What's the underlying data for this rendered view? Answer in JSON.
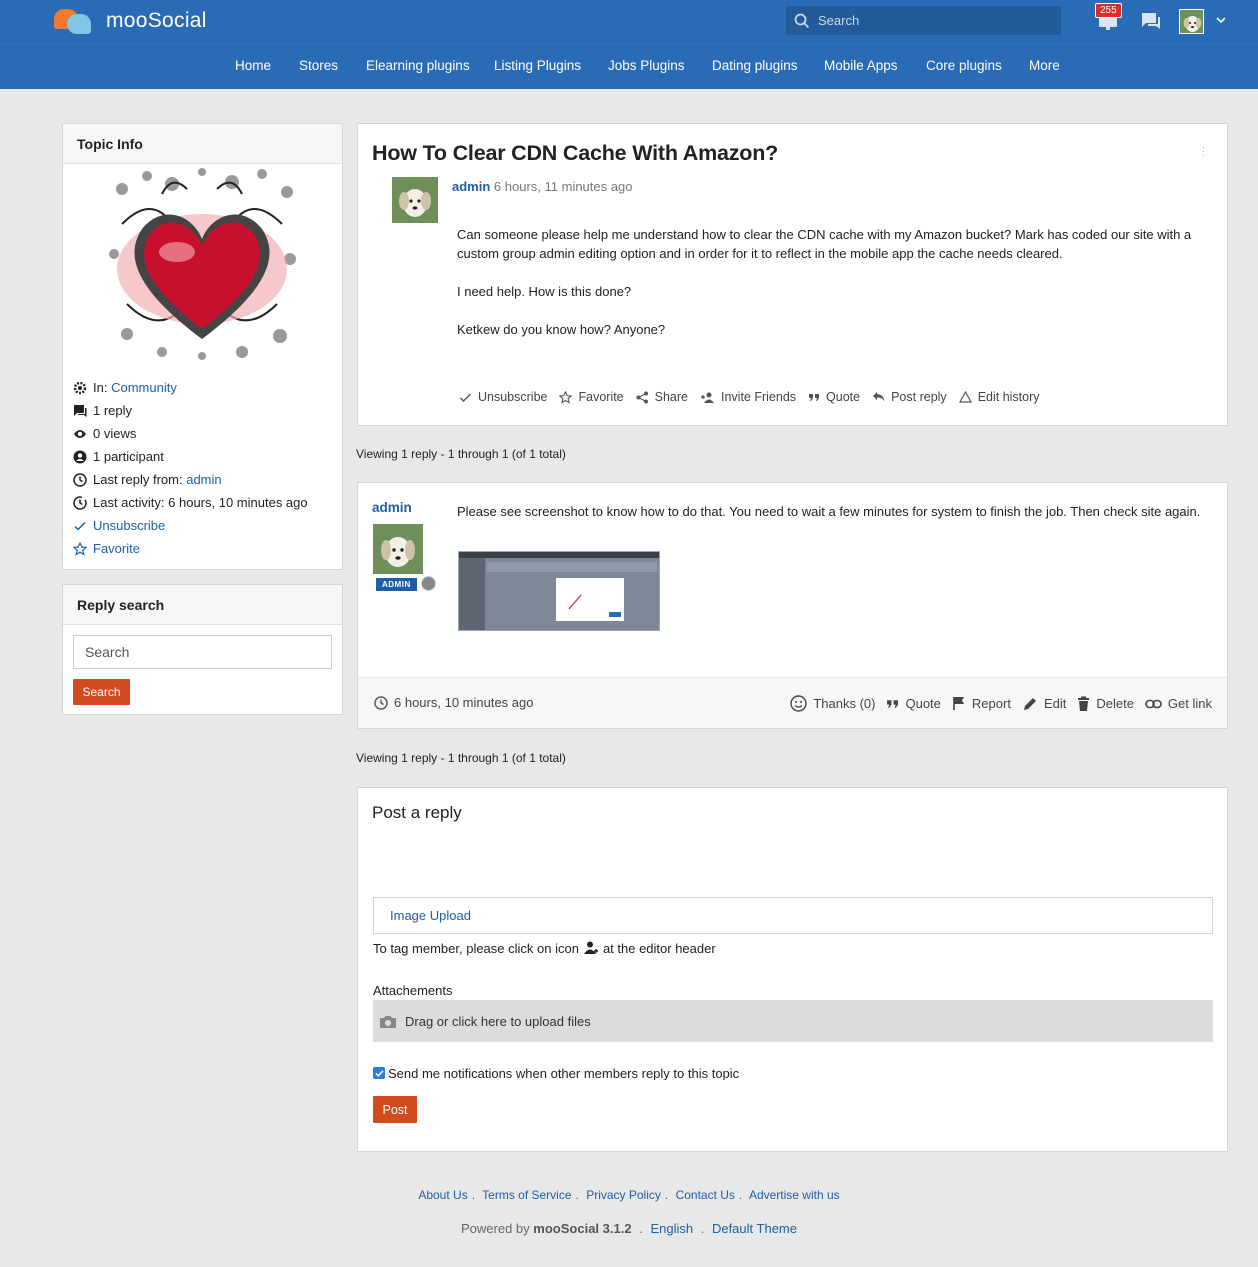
{
  "header": {
    "logo_text": "mooSocial",
    "search_placeholder": "Search",
    "notification_count": "255"
  },
  "nav": {
    "items": [
      "Home",
      "Stores",
      "Elearning plugins",
      "Listing Plugins",
      "Jobs Plugins",
      "Dating plugins",
      "Mobile Apps",
      "Core plugins",
      "More"
    ]
  },
  "topic_info": {
    "heading": "Topic Info",
    "in_label": "In:",
    "in_link": "Community",
    "replies": "1 reply",
    "views": "0 views",
    "participants": "1 participant",
    "last_reply_label": "Last reply from:",
    "last_reply_user": "admin",
    "last_activity": "Last activity: 6 hours, 10 minutes ago",
    "unsubscribe": "Unsubscribe",
    "favorite": "Favorite"
  },
  "reply_search": {
    "heading": "Reply search",
    "placeholder": "Search",
    "button": "Search"
  },
  "topic": {
    "title": "How To Clear CDN Cache With Amazon?",
    "author": "admin",
    "time": "6 hours, 11 minutes ago",
    "body": [
      "Can someone please help me understand how to clear the CDN cache with my Amazon bucket? Mark has coded our site with a custom group admin editing option and in order for it to reflect in the mobile app the cache needs cleared.",
      "I need help. How is this done?",
      "Ketkew do you know how? Anyone?"
    ],
    "actions": {
      "unsubscribe": "Unsubscribe",
      "favorite": "Favorite",
      "share": "Share",
      "invite": "Invite Friends",
      "quote": "Quote",
      "post_reply": "Post reply",
      "edit_history": "Edit history"
    }
  },
  "viewing_text": "Viewing 1 reply - 1 through 1 (of 1 total)",
  "reply": {
    "author": "admin",
    "badge": "ADMIN",
    "text": "Please see screenshot to know how to do that. You need to wait a few minutes for system to finish the job. Then check site again.",
    "time": "6 hours, 10 minutes ago",
    "actions": {
      "thanks": "Thanks (0)",
      "quote": "Quote",
      "report": "Report",
      "edit": "Edit",
      "delete": "Delete",
      "get_link": "Get link"
    }
  },
  "post_reply": {
    "title": "Post a reply",
    "image_upload": "Image Upload",
    "tag_note_before": "To tag member, please click on icon",
    "tag_note_after": "at the editor header",
    "attachments_label": "Attachements",
    "dropzone_text": "Drag or click here to upload files",
    "notify_label": "Send me notifications when other members reply to this topic",
    "notify_checked": true,
    "post_button": "Post"
  },
  "footer": {
    "links": [
      "About Us",
      "Terms of Service",
      "Privacy Policy",
      "Contact Us",
      "Advertise with us"
    ],
    "powered_prefix": "Powered by",
    "powered_brand": "mooSocial 3.1.2",
    "language": "English",
    "theme": "Default Theme"
  },
  "colors": {
    "brand_blue": "#2a6bb5",
    "link_blue": "#1f5fa6",
    "button_red": "#d24b1f",
    "badge_red": "#e02b2b"
  }
}
